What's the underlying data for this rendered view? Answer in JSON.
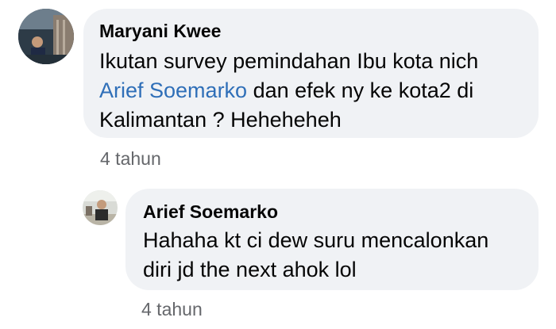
{
  "comment": {
    "author": "Maryani Kwee",
    "text_before": "Ikutan survey pemindahan Ibu kota nich",
    "mention": "Arief Soemarko",
    "text_after": " dan efek ny ke kota2 di Kalimantan ? Heheheheh",
    "time": "4 tahun"
  },
  "reply": {
    "author": "Arief Soemarko",
    "text": "Hahaha kt ci dew suru mencalonkan diri jd the next ahok lol",
    "time": "4 tahun"
  },
  "colors": {
    "bubble_bg": "#f0f2f5",
    "mention": "#2f6fb8",
    "meta": "#65676b"
  }
}
